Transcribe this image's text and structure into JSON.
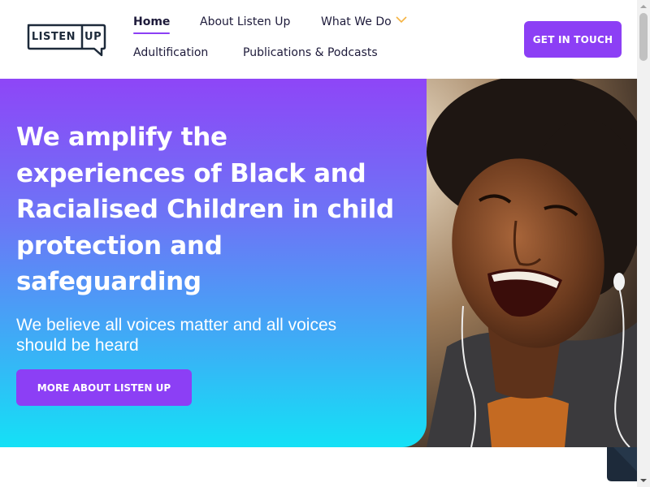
{
  "brand": {
    "logo_text": "LISTEN UP",
    "color_primary": "#8c3ff5",
    "color_dark": "#1d2a3a"
  },
  "nav": {
    "home": "Home",
    "about": "About Listen Up",
    "what_we_do": "What We Do",
    "adultification": "Adultification",
    "publications": "Publications & Podcasts",
    "cta": "GET IN TOUCH"
  },
  "hero": {
    "title": "We amplify the experiences of Black and Racialised Children in child protection and safeguarding",
    "subtitle": "We believe all voices matter and all voices should be heard",
    "button": "MORE ABOUT LISTEN UP",
    "gradient_top": "#8e46f7",
    "gradient_bottom": "#14e1f6"
  },
  "icons": {
    "dropdown": "chevron-down-icon",
    "scroll_up": "arrow-up-icon",
    "scroll_down": "arrow-down-icon"
  }
}
